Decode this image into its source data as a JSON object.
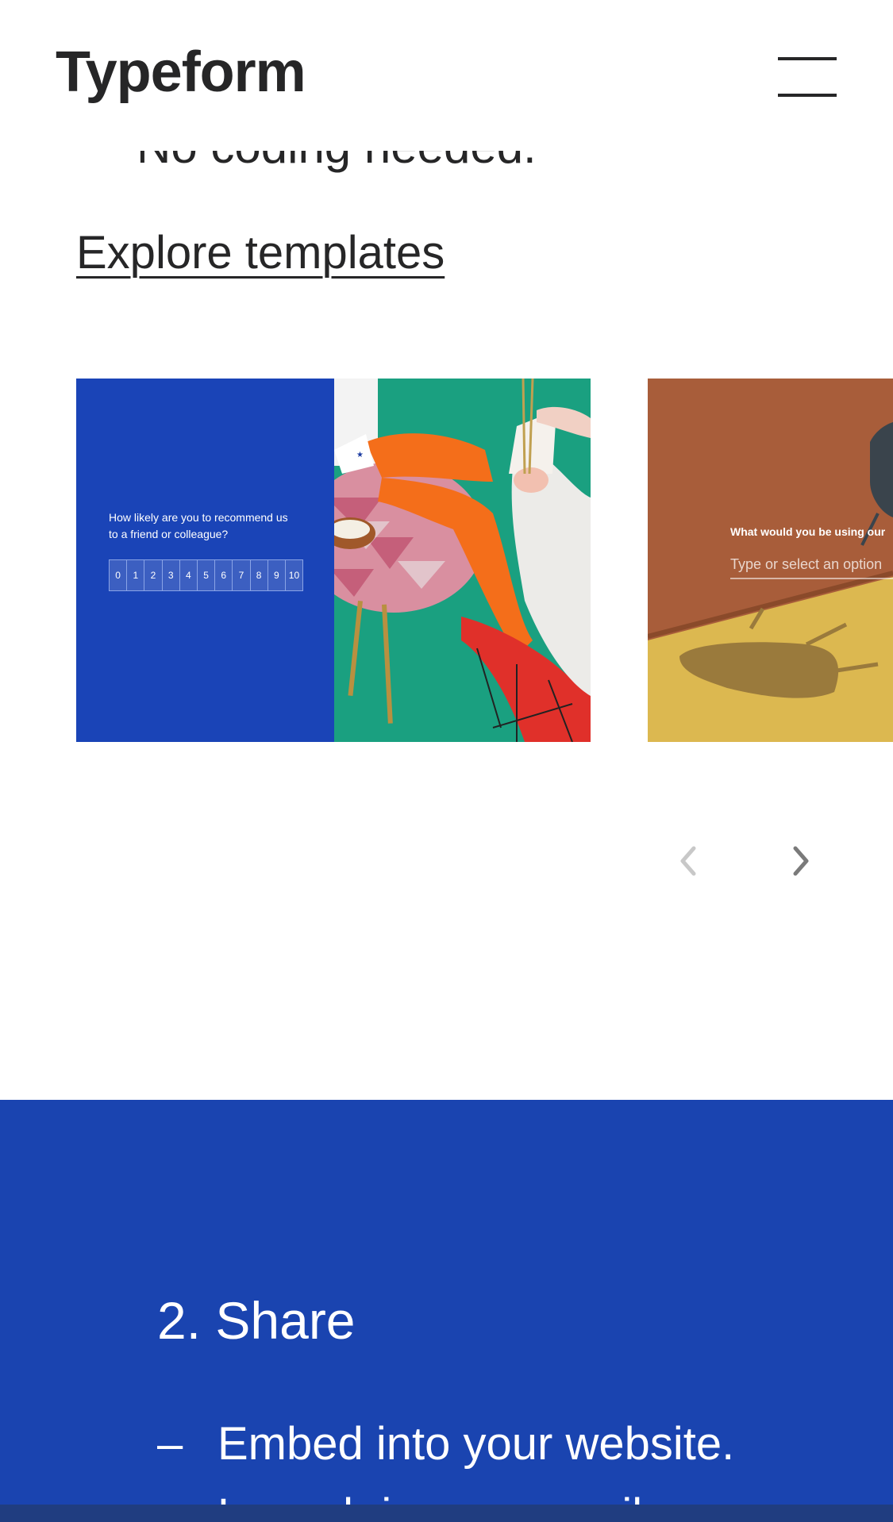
{
  "header": {
    "logo": "Typeform",
    "menu_icon": "hamburger-menu-icon"
  },
  "intro": {
    "clipped_line": "No coding needed.",
    "explore_link": "Explore templates"
  },
  "carousel": {
    "card1": {
      "question": "How likely are you to recommend us to a friend or colleague?",
      "scale": [
        "0",
        "1",
        "2",
        "3",
        "4",
        "5",
        "6",
        "7",
        "8",
        "9",
        "10"
      ],
      "background": "#1a44b7",
      "photo_colors": {
        "backdrop": "#1aa080",
        "tights": "#f46e1a",
        "chair": "#e0302a"
      }
    },
    "card2": {
      "question": "What would you be using our",
      "input_placeholder": "Type or select an option",
      "background_top": "#a85d3a",
      "background_floor": "#dcb850"
    },
    "prev_icon": "chevron-left-icon",
    "next_icon": "chevron-right-icon"
  },
  "share": {
    "title": "2. Share",
    "bullet": "–",
    "items": [
      "Embed into your website.",
      "Launch in your email"
    ],
    "background": "#1a44b0"
  }
}
